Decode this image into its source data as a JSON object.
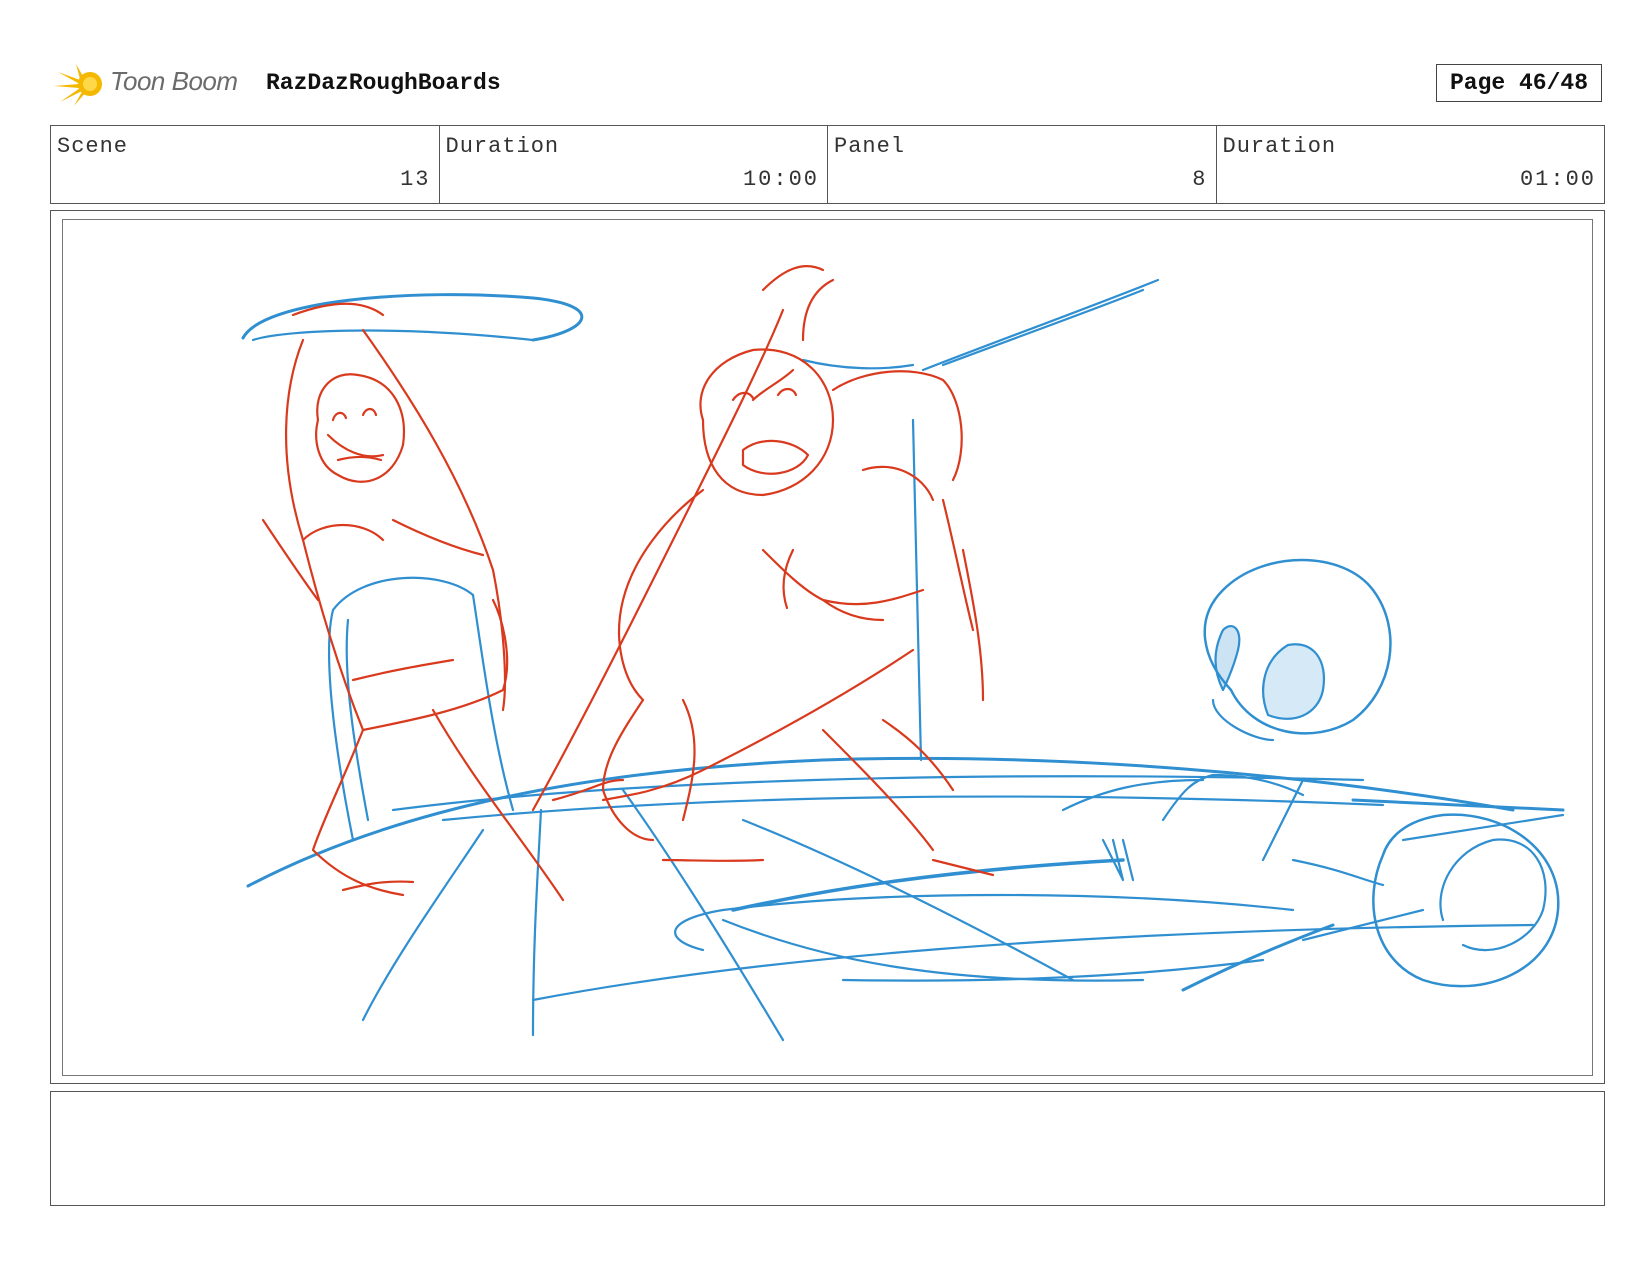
{
  "header": {
    "logo_text": "Toon Boom",
    "project_title": "RazDazRoughBoards",
    "page_label": "Page 46/48"
  },
  "info": {
    "scene": {
      "label": "Scene",
      "value": "13"
    },
    "scene_duration": {
      "label": "Duration",
      "value": "10:00"
    },
    "panel": {
      "label": "Panel",
      "value": "8"
    },
    "panel_duration": {
      "label": "Duration",
      "value": "01:00"
    }
  },
  "colors": {
    "sketch_red": "#d93a1e",
    "sketch_blue": "#2f8fd0",
    "logo_yellow": "#f5b800"
  },
  "notes": {
    "text": ""
  }
}
